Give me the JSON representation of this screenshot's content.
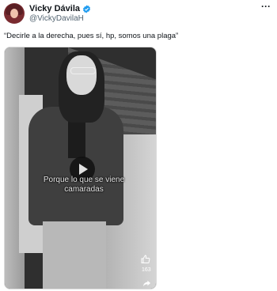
{
  "author": {
    "display_name": "Vicky Dávila",
    "handle": "@VickyDavilaH",
    "verified": true
  },
  "menu_icon": "more-icon",
  "menu_label": "···",
  "tweet": {
    "text": "“Decirle a la derecha, pues sí, hp, somos una plaga”"
  },
  "video": {
    "caption_line1": "Porque lo que se viene",
    "caption_line2": "camaradas",
    "like_count": "163"
  },
  "colors": {
    "verified_badge": "#1d9bf0",
    "text_primary": "#0f1419",
    "text_secondary": "#536471"
  }
}
